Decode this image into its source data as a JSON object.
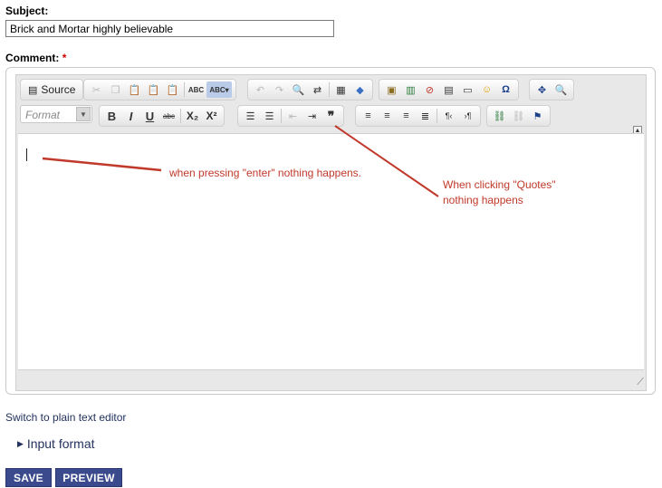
{
  "subject": {
    "label": "Subject:",
    "value": "Brick and Mortar highly believable"
  },
  "comment": {
    "label": "Comment:",
    "required_marker": "*"
  },
  "toolbar": {
    "source_label": "Source",
    "format_placeholder": "Format",
    "row1_icons": [
      "cut-icon",
      "copy-icon",
      "paste-icon",
      "paste-text-icon",
      "paste-word-icon",
      "spellcheck-icon",
      "spellcheck-as-you-type-icon",
      "undo-icon",
      "redo-icon",
      "find-icon",
      "replace-icon",
      "select-all-icon",
      "remove-format-icon",
      "image-icon",
      "flash-icon",
      "no-icon",
      "table-icon",
      "horizontal-rule-icon",
      "smiley-icon",
      "special-char-icon",
      "iframe-icon",
      "preview-icon"
    ],
    "row2_labels": {
      "bold": "B",
      "italic": "I",
      "underline": "U",
      "strike": "abc",
      "subscript": "X₂",
      "superscript": "X²",
      "blockquote": "❞"
    }
  },
  "annotations": {
    "enter": "when pressing \"enter\" nothing happens.",
    "quotes_line1": "When clicking \"Quotes\"",
    "quotes_line2": "nothing happens"
  },
  "links": {
    "switch_editor": "Switch to plain text editor"
  },
  "input_format": {
    "label": "Input format"
  },
  "buttons": {
    "save": "SAVE",
    "preview": "PREVIEW"
  },
  "colors": {
    "annotation": "#c0392b",
    "button_bg": "#3b4a8c",
    "link": "#23325e"
  }
}
